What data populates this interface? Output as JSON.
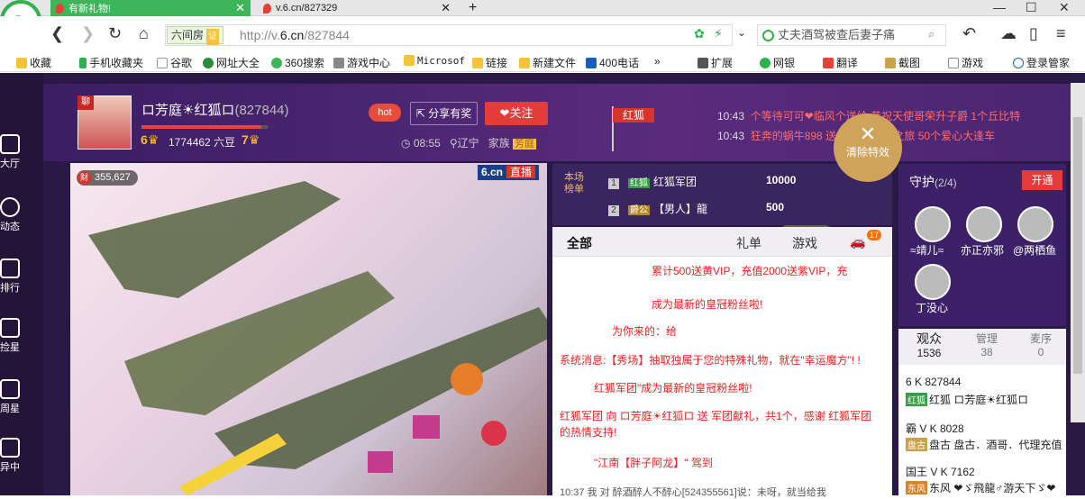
{
  "browser": {
    "tabs": [
      {
        "label": "有新礼物!",
        "active": true
      },
      {
        "label": "v.6.cn/827329",
        "active": false
      }
    ],
    "new_tab": "+",
    "url_badge": "六间房",
    "url_badge_tag": "证",
    "url_prefix": "http://v.",
    "url_domain": "6.cn",
    "url_path": "/827844",
    "search_text": "丈夫酒驾被查后妻子痛",
    "bookmarks": [
      "收藏",
      "手机收藏夹",
      "谷歌",
      "网址大全",
      "360搜索",
      "游戏中心",
      "Microsof",
      "链接",
      "新建文件",
      "400电话",
      "扩展",
      "网银",
      "翻译",
      "截图",
      "游戏",
      "登录管家"
    ],
    "bookmarks_more": "»"
  },
  "left_nav": [
    "大厅",
    "动态",
    "排行",
    "捡星",
    "周星",
    "异中"
  ],
  "anchor": {
    "badge": "聊",
    "name": "ロ芳庭☀红狐ロ",
    "id": "(827844)",
    "level_left": "6",
    "liudou": "1774462 六豆",
    "level_right": "7",
    "level_progress": 0.95,
    "hot": "hot",
    "share": "分享有奖",
    "follow": "关注",
    "time": "08:55",
    "location": "辽宁",
    "family_label": "家族",
    "family": "芳庭",
    "flag": "红狐"
  },
  "notices": [
    {
      "time": "10:43",
      "text": "个等待可可❤临风个送给 恭祝天使哥荣升子爵 1个丘比特"
    },
    {
      "time": "10:43",
      "text": "狂奔的蜗牛898 送给 红狐扶贫之旅 50个爱心大逢车"
    }
  ],
  "clear_fx": {
    "x": "✕",
    "label": "清除特效"
  },
  "video": {
    "fortune": "355,627",
    "logo": "6.cn",
    "live": "直播"
  },
  "ranking": {
    "title": "本场榜单",
    "rows": [
      {
        "rank": "1",
        "badge": "红狐",
        "name": "红狐军团",
        "value": "10000"
      },
      {
        "rank": "2",
        "badge": "爵公",
        "name": "【男人】龍",
        "value": "500"
      }
    ]
  },
  "chat": {
    "tabs": [
      "全部",
      "礼单",
      "游戏"
    ],
    "car_count": "17",
    "messages": [
      {
        "text": "累计500送黄VIP，充值2000送紫VIP，充"
      },
      {
        "text": "成为最新的皇冠粉丝啦!"
      },
      {
        "text": "为你来的：给"
      },
      {
        "text": "系统消息:【秀场】抽取独属于您的特殊礼物，就在\"幸运魔方\"! !"
      },
      {
        "text": "红狐军团\"成为最新的皇冠粉丝啦!"
      },
      {
        "text": "红狐军团 向 ロ芳庭☀红狐ロ 送 军团献礼，共1个，感谢 红狐军团 的热情支持!"
      },
      {
        "text": "\"江南【胖子阿龙】\" 驾到"
      }
    ],
    "bottom": "10:37  我 对 醉酒醉人不醉心[524355561]说：未呀，就当给我"
  },
  "guard": {
    "title": "守护",
    "count": "(2/4)",
    "open": "开通",
    "members": [
      "≈靖儿≈",
      "亦正亦邪",
      "@两栖鱼",
      "丁没心"
    ]
  },
  "audience": {
    "tabs": [
      {
        "label": "观众",
        "count": "1536"
      },
      {
        "label": "管理",
        "count": "38"
      },
      {
        "label": "麦序",
        "count": "0"
      }
    ],
    "items": [
      {
        "line1": "6 K 827844",
        "line2": "红狐 ロ芳庭☀红狐ロ"
      },
      {
        "line1": "霸 V K 8028",
        "line2": "盘古 盘古．酒哥．代理充值"
      },
      {
        "line1": "国王 V K 7162",
        "line2": "东风 ❤ゞ飛龍♂游天下ゞ❤"
      }
    ]
  },
  "colors": {
    "brand_green": "#3db55b",
    "accent_red": "#e43b3b",
    "page_purple": "#2a1947",
    "gold": "#cfa35a"
  }
}
